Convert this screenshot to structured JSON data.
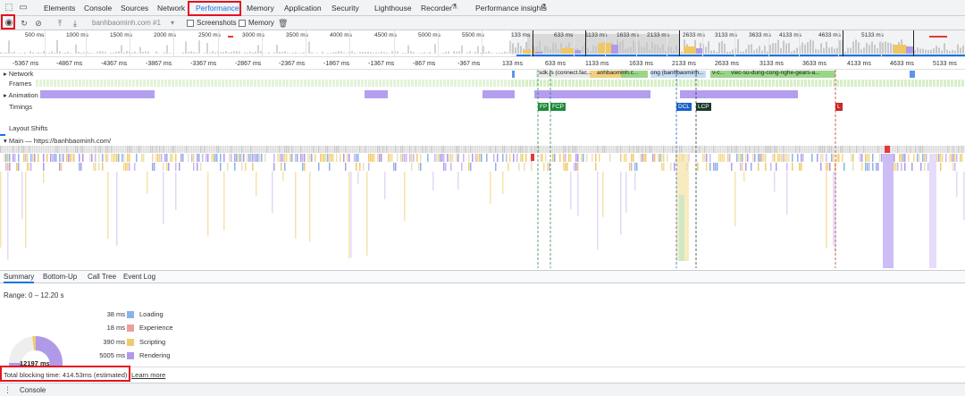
{
  "tabs": [
    "Elements",
    "Console",
    "Sources",
    "Network",
    "Performance",
    "Memory",
    "Application",
    "Security",
    "Lighthouse",
    "Recorder",
    "Performance insights"
  ],
  "active_tab": "Performance",
  "toolbar": {
    "profile_select": "banhbaominh.com #1",
    "screenshots_label": "Screenshots",
    "memory_label": "Memory"
  },
  "overview_ticks": [
    "500 ms",
    "1000 ms",
    "1500 ms",
    "2000 ms",
    "2500 ms",
    "3000 ms",
    "3500 ms",
    "4000 ms",
    "4500 ms",
    "5000 ms",
    "5500 ms",
    "133 ms",
    "633 ms",
    "1133 ms",
    "1633 ms",
    "2133 ms",
    "2633 ms",
    "3133 ms",
    "3633 ms",
    "4133 ms",
    "4633 ms",
    "5133 ms"
  ],
  "ruler_ticks": [
    "-5367 ms",
    "-4867 ms",
    "-4367 ms",
    "-3867 ms",
    "-3367 ms",
    "-2867 ms",
    "-2367 ms",
    "-1867 ms",
    "-1367 ms",
    "-867 ms",
    "-367 ms",
    "133 ms",
    "633 ms",
    "1133 ms",
    "1633 ms",
    "2133 ms",
    "2633 ms",
    "3133 ms",
    "3633 ms",
    "4133 ms",
    "4633 ms",
    "5133 ms"
  ],
  "tracks": {
    "network": "Network",
    "frames": "Frames",
    "animation": "Animation",
    "timings": "Timings",
    "layout_shifts": "Layout Shifts",
    "main": "Main — https://banhbaominh.com/"
  },
  "network_items": [
    "sdk.js (connect.fac...",
    "anhbaominh.c...",
    "ong (banhbaominh...",
    "v-c...",
    "viec-su-dung-cong-nghe-gears-a..."
  ],
  "timing_markers": [
    "FP",
    "FCP",
    "DCL",
    "LCP",
    "L"
  ],
  "bottom_tabs": [
    "Summary",
    "Bottom-Up",
    "Call Tree",
    "Event Log"
  ],
  "summary": {
    "range": "Range: 0 – 12.20 s",
    "total": "12197 ms",
    "items": [
      {
        "value": "38 ms",
        "name": "Loading",
        "color": "#8ab4e8"
      },
      {
        "value": "18 ms",
        "name": "Experience",
        "color": "#e8a09a"
      },
      {
        "value": "390 ms",
        "name": "Scripting",
        "color": "#f0ca6e"
      },
      {
        "value": "5005 ms",
        "name": "Rendering",
        "color": "#b09ae8"
      }
    ]
  },
  "footer": {
    "blocking": "Total blocking time: 414.53ms (estimated)",
    "learn_more": "Learn more"
  },
  "drawer": {
    "console": "Console"
  }
}
